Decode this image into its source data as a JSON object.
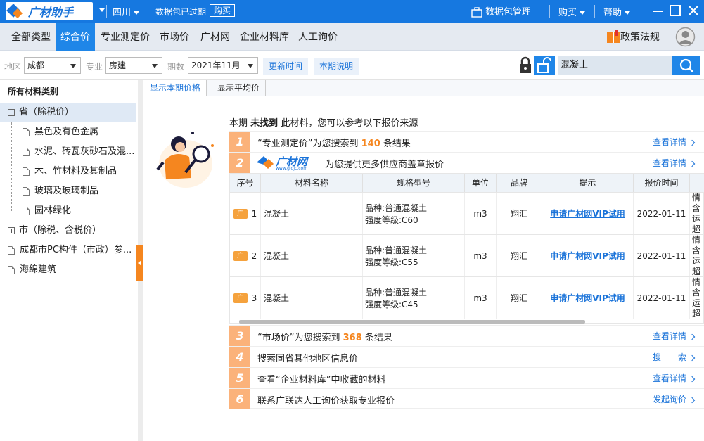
{
  "titlebar": {
    "logo_text": "广材助手",
    "region": "四川",
    "notice": "数据包已过期",
    "buy_button": "购买",
    "data_mgmt": "数据包管理",
    "buy_menu": "购买",
    "help_menu": "帮助"
  },
  "menubar": {
    "items": [
      "全部类型",
      "综合价",
      "专业测定价",
      "市场价",
      "广材网",
      "企业材料库",
      "人工询价"
    ],
    "active_index": 1,
    "policy": "政策法规"
  },
  "filters": {
    "region_label": "地区",
    "region_value": "成都",
    "major_label": "专业",
    "major_value": "房建",
    "period_label": "期数",
    "period_value": "2021年11月",
    "update_time_btn": "更新时间",
    "period_desc_btn": "本期说明",
    "search_value": "混凝土"
  },
  "sidebar": {
    "header": "所有材料类别",
    "items": [
      {
        "label": "省（除税价）",
        "type": "expanded"
      },
      {
        "label": "黑色及有色金属",
        "type": "doc"
      },
      {
        "label": "水泥、砖瓦灰砂石及混...",
        "type": "doc"
      },
      {
        "label": "木、竹材料及其制品",
        "type": "doc"
      },
      {
        "label": "玻璃及玻璃制品",
        "type": "doc"
      },
      {
        "label": "园林绿化",
        "type": "doc"
      },
      {
        "label": "市（除税、含税价）",
        "type": "collapsed"
      },
      {
        "label": "成都市PC构件（市政）参...",
        "type": "doc"
      },
      {
        "label": "海绵建筑",
        "type": "doc"
      }
    ]
  },
  "tabs": [
    "显示本期价格",
    "显示平均价"
  ],
  "intro": {
    "prefix": "本期",
    "bold": "未找到",
    "suffix": "此材料，您可以参考以下报价来源"
  },
  "results": {
    "row1": {
      "num": "1",
      "pre": "“专业测定价”为您搜索到",
      "count": "140",
      "post": "条结果",
      "link": "查看详情"
    },
    "row2": {
      "num": "2",
      "logo": "广材网",
      "logo_url_text": "www.gldjc.com",
      "text": "为您提供更多供应商盖章报价",
      "link": "查看详情"
    },
    "row3": {
      "num": "3",
      "pre": "“市场价”为您搜索到",
      "count": "368",
      "post": "条结果",
      "link": "查看详情"
    },
    "row4": {
      "num": "4",
      "text": "搜索同省其他地区信息价",
      "link": "搜　　索"
    },
    "row5": {
      "num": "5",
      "text": "查看“企业材料库”中收藏的材料",
      "link": "查看详情"
    },
    "row6": {
      "num": "6",
      "text": "联系广联达人工询价获取专业报价",
      "link": "发起询价"
    }
  },
  "table": {
    "headers": [
      "序号",
      "材料名称",
      "规格型号",
      "单位",
      "品牌",
      "提示",
      "报价时间",
      ""
    ],
    "rows": [
      {
        "no": "1",
        "tag": "广",
        "name": "混凝土",
        "spec1": "品种:普通混凝土",
        "spec2": "强度等级:C60",
        "unit": "m3",
        "brand": "翔汇",
        "tip": "申请广材网VIP试用",
        "time": "2022-01-11",
        "extra1": "详情",
        "extra2": "含运",
        "extra3": "超出"
      },
      {
        "no": "2",
        "tag": "广",
        "name": "混凝土",
        "spec1": "品种:普通混凝土",
        "spec2": "强度等级:C55",
        "unit": "m3",
        "brand": "翔汇",
        "tip": "申请广材网VIP试用",
        "time": "2022-01-11",
        "extra1": "详情",
        "extra2": "含运",
        "extra3": "超出"
      },
      {
        "no": "3",
        "tag": "广",
        "name": "混凝土",
        "spec1": "品种:普通混凝土",
        "spec2": "强度等级:C45",
        "unit": "m3",
        "brand": "翔汇",
        "tip": "申请广材网VIP试用",
        "time": "2022-01-11",
        "extra1": "详情",
        "extra2": "含运",
        "extra3": "超出"
      }
    ]
  }
}
